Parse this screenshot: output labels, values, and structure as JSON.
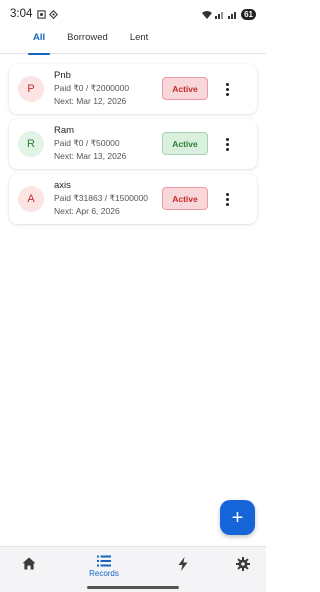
{
  "status_bar": {
    "time": "3:04",
    "battery": "61"
  },
  "tabs": [
    {
      "label": "All",
      "active": true
    },
    {
      "label": "Borrowed",
      "active": false
    },
    {
      "label": "Lent",
      "active": false
    }
  ],
  "records": [
    {
      "initial": "P",
      "name": "Pnb",
      "paid": "Paid ₹0 / ₹2000000",
      "next": "Next: Mar 12, 2026",
      "status": "Active",
      "color": "red"
    },
    {
      "initial": "R",
      "name": "Ram",
      "paid": "Paid ₹0 / ₹50000",
      "next": "Next: Mar 13, 2026",
      "status": "Active",
      "color": "green"
    },
    {
      "initial": "A",
      "name": "axis",
      "paid": "Paid ₹31863 / ₹1500000",
      "next": "Next: Apr 6, 2026",
      "status": "Active",
      "color": "red"
    }
  ],
  "fab": {
    "icon": "plus-icon",
    "glyph": "+"
  },
  "bottom_nav": [
    {
      "icon": "home-icon",
      "label": ""
    },
    {
      "icon": "list-icon",
      "label": "Records",
      "active": true
    },
    {
      "icon": "bolt-icon",
      "label": ""
    },
    {
      "icon": "gear-icon",
      "label": ""
    }
  ],
  "colors": {
    "accent": "#1565c0",
    "fab": "#1565d8",
    "active_red_bg": "#f8d7da",
    "active_green_bg": "#d9f0df"
  }
}
